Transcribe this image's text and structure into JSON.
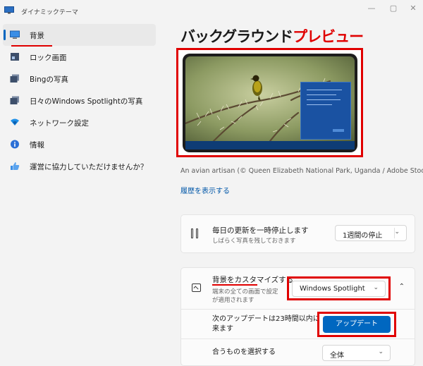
{
  "window": {
    "title": "ダイナミックテーマ",
    "minimize": "—",
    "maximize": "▢",
    "close": "✕"
  },
  "sidebar": {
    "items": [
      {
        "label": "背景",
        "icon": "desktop-icon",
        "active": true
      },
      {
        "label": "ロック画面",
        "icon": "lock-screen-icon",
        "active": false
      },
      {
        "label": "Bingの写真",
        "icon": "photos-icon",
        "active": false
      },
      {
        "label": "日々のWindows Spotlightの写真",
        "icon": "spotlight-photos-icon",
        "active": false
      },
      {
        "label": "ネットワーク設定",
        "icon": "wifi-icon",
        "active": false
      },
      {
        "label": "情報",
        "icon": "info-icon",
        "active": false
      },
      {
        "label": "運営に協力していただけませんか？",
        "icon": "thumbs-up-icon",
        "active": false
      }
    ]
  },
  "main": {
    "title_part1": "バックグラウンド",
    "title_part2": "プレビュー",
    "caption": "An avian artisan (© Queen Elizabeth National Park, Uganda / Adobe Stock)",
    "history_link": "履歴を表示する",
    "pause": {
      "title": "毎日の更新を一時停止します",
      "subtitle": "しばらく写真を残しておきます",
      "dropdown_value": "1週間の停止"
    },
    "customize": {
      "title": "背景をカスタマイズする",
      "subtitle_line1": "端末の全ての画面で設定",
      "subtitle_line2": "が適用されます",
      "dropdown_value": "Windows Spotlight",
      "next_update_line1": "次のアップデートは23時間以内に",
      "next_update_line2": "来ます",
      "update_button": "アップデート",
      "match_label": "合うものを選択する",
      "match_value": "全体"
    }
  },
  "colors": {
    "accent": "#0067c0",
    "highlight_red": "#e00000",
    "background": "#f3f3f3"
  }
}
